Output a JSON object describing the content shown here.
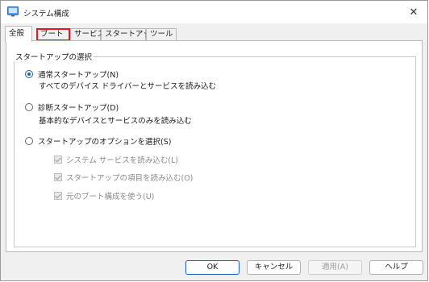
{
  "window": {
    "title": "システム構成",
    "close_label": "✕"
  },
  "tabs": [
    {
      "label": "全般"
    },
    {
      "label": "ブート"
    },
    {
      "label": "サービス"
    },
    {
      "label": "スタートアップ"
    },
    {
      "label": "ツール"
    }
  ],
  "group": {
    "label": "スタートアップの選択"
  },
  "options": {
    "normal": {
      "label": "通常スタートアップ(N)",
      "desc": "すべてのデバイス ドライバーとサービスを読み込む",
      "selected": true
    },
    "diagnostic": {
      "label": "診断スタートアップ(D)",
      "desc": "基本的なデバイスとサービスのみを読み込む",
      "selected": false
    },
    "selective": {
      "label": "スタートアップのオプションを選択(S)",
      "selected": false
    }
  },
  "checkboxes": [
    {
      "label": "システム サービスを読み込む(L)",
      "checked": true
    },
    {
      "label": "スタートアップの項目を読み込む(O)",
      "checked": true
    },
    {
      "label": "元のブート構成を使う(U)",
      "checked": true
    }
  ],
  "buttons": {
    "ok": "OK",
    "cancel": "キャンセル",
    "apply": "適用(A)",
    "help": "ヘルプ"
  },
  "colors": {
    "accent": "#1a5fb4",
    "highlight": "#e01b24"
  }
}
